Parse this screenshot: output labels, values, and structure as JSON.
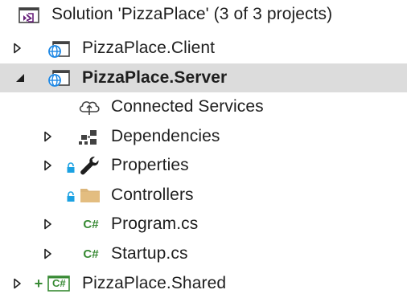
{
  "solution_explorer": {
    "solution": {
      "label": "Solution 'PizzaPlace' (3 of 3 projects)",
      "icon": "visual-studio-solution-icon"
    },
    "items": [
      {
        "label": "PizzaPlace.Client",
        "icon": "web-project-icon",
        "expanded": false
      },
      {
        "label": "PizzaPlace.Server",
        "icon": "web-project-icon",
        "expanded": true,
        "selected": true
      },
      {
        "label": "Connected Services",
        "icon": "connected-services-icon"
      },
      {
        "label": "Dependencies",
        "icon": "dependencies-icon",
        "expanded": false
      },
      {
        "label": "Properties",
        "icon": "wrench-icon",
        "expanded": false,
        "locked": true
      },
      {
        "label": "Controllers",
        "icon": "folder-icon",
        "locked": true
      },
      {
        "label": "Program.cs",
        "icon": "csharp-file-icon",
        "expanded": false
      },
      {
        "label": "Startup.cs",
        "icon": "csharp-file-icon",
        "expanded": false
      },
      {
        "label": "PizzaPlace.Shared",
        "icon": "csharp-project-icon",
        "expanded": false,
        "added": true
      }
    ]
  },
  "colors": {
    "selection": "#dcdcdc",
    "csharp_green": "#388a34",
    "vs_purple": "#68217a",
    "web_blue": "#1e88e5",
    "folder": "#dcb67a",
    "lock_blue": "#1ba1e2"
  },
  "glyphs": {
    "csharp": "C#",
    "plus": "+"
  }
}
